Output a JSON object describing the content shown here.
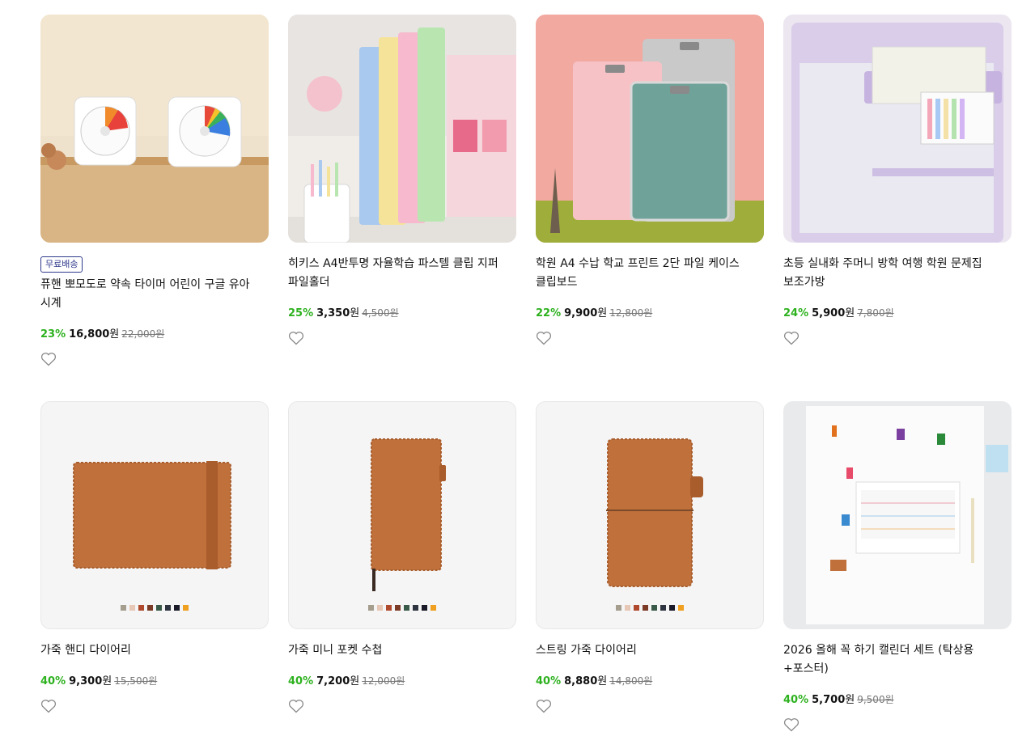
{
  "products": [
    {
      "badge": "무료배송",
      "name": "퓨핸 뽀모도로 약속 타이머 어린이 구글 유아 시계",
      "discount": "23%",
      "price": "16,800",
      "won": "원",
      "original": "22,000원",
      "image": "timer-clocks-photo"
    },
    {
      "name": "히키스 A4반투명 자율학습 파스텔 클립 지퍼 파일홀더",
      "discount": "25%",
      "price": "3,350",
      "won": "원",
      "original": "4,500원",
      "image": "pastel-file-holders-photo"
    },
    {
      "name": "학원 A4 수납 학교 프린트 2단 파일 케이스 클립보드",
      "discount": "22%",
      "price": "9,900",
      "won": "원",
      "original": "12,800원",
      "image": "clipboards-photo"
    },
    {
      "name": "초등 실내화 주머니 방학 여행 학원 문제집 보조가방",
      "discount": "24%",
      "price": "5,900",
      "won": "원",
      "original": "7,800원",
      "image": "mesh-pouch-bag-photo"
    },
    {
      "name": "가죽 핸디 다이어리",
      "discount": "40%",
      "price": "9,300",
      "won": "원",
      "original": "15,500원",
      "image": "leather-handy-diary-photo"
    },
    {
      "name": "가죽 미니 포켓 수첩",
      "discount": "40%",
      "price": "7,200",
      "won": "원",
      "original": "12,000원",
      "image": "leather-pocket-notebook-photo"
    },
    {
      "name": "스트링 가죽 다이어리",
      "discount": "40%",
      "price": "8,880",
      "won": "원",
      "original": "14,800원",
      "image": "string-leather-diary-photo"
    },
    {
      "name": "2026 올해 꼭 하기 캘린더 세트 (탁상용+포스터)",
      "discount": "40%",
      "price": "5,700",
      "won": "원",
      "original": "9,500원",
      "image": "calendar-set-photo"
    }
  ],
  "colors": {
    "discount": "#2db11e",
    "badge_border": "#2e3a8c",
    "leather": "#c0703a",
    "swatches": [
      "#a59d8d",
      "#e7c7b5",
      "#b04a2e",
      "#7c3b26",
      "#3a5a49",
      "#2e3440",
      "#1a1a28",
      "#f0a020"
    ]
  },
  "icons": {
    "wishlist": "heart-outline-icon"
  }
}
